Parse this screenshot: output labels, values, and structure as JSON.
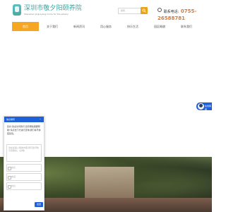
{
  "header": {
    "logo_name": "深圳市敬夕阳颐养院",
    "logo_subtitle": "Shenzhen Jingxiyang home for the elderly",
    "search_placeholder": "搜索",
    "phone_label": "联系电话:",
    "phone_number": "0755-26588781"
  },
  "nav": {
    "items": [
      {
        "label": "首页"
      },
      {
        "label": "关于我们"
      },
      {
        "label": "新闻资讯"
      },
      {
        "label": "用心服务"
      },
      {
        "label": "快乐生活"
      },
      {
        "label": "园区概貌"
      },
      {
        "label": "联系我们"
      }
    ]
  },
  "chat": {
    "title": "信息填写",
    "message": "您好,欢迎访问我们,您有哪些需要帮助?请点击下方进行咨询,我们将尽快回复您。",
    "textarea_placeholder": "请在此输入留言内容,我们会尽快与您联系。(必填)",
    "name_placeholder": "姓名",
    "phone_placeholder": "电话",
    "address_placeholder": "地址",
    "send_label": "发送"
  },
  "service": {
    "label": "在线客服"
  },
  "colors": {
    "brand": "#39a7a2",
    "nav_active": "#f5a623",
    "search_button": "#e8a317",
    "phone_number": "#e0762b",
    "chat_primary": "#1e60d8"
  }
}
